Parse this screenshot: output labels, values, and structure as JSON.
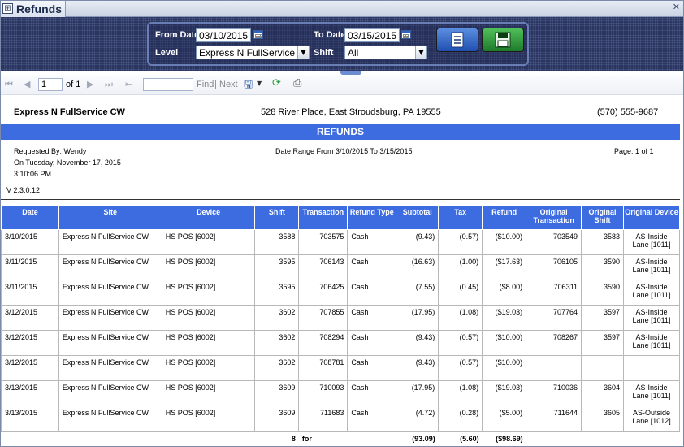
{
  "tab": {
    "title": "Refunds"
  },
  "params": {
    "from_date_label": "From Date",
    "from_date_value": "03/10/2015",
    "to_date_label": "To Date",
    "to_date_value": "03/15/2015",
    "level_label": "Level",
    "level_value": "Express N FullService CW",
    "shift_label": "Shift",
    "shift_value": "All"
  },
  "toolbar": {
    "page_value": "1",
    "page_of": "of 1",
    "find_label": "Find",
    "separator": "|",
    "next_label": "Next"
  },
  "report": {
    "company": "Express N FullService CW",
    "address": "528 River Place, East Stroudsburg, PA 19555",
    "phone": "(570) 555-9687",
    "title": "REFUNDS",
    "requested_by": "Requested By: Wendy",
    "on_date": "On Tuesday, November 17, 2015",
    "time": "3:10:06 PM",
    "date_range": "Date Range From 3/10/2015 To 3/15/2015",
    "page": "Page: 1 of 1",
    "version": "V 2.3.0.12"
  },
  "table": {
    "headers": [
      "Date",
      "Site",
      "Device",
      "Shift",
      "Transaction",
      "Refund Type",
      "Subtotal",
      "Tax",
      "Refund",
      "Original Transaction",
      "Original Shift",
      "Original Device"
    ],
    "rows": [
      [
        "3/10/2015",
        "Express N FullService CW",
        "HS POS [6002]",
        "3588",
        "703575",
        "Cash",
        "(9.43)",
        "(0.57)",
        "($10.00)",
        "703549",
        "3583",
        "AS-Inside Lane [1011]"
      ],
      [
        "3/11/2015",
        "Express N FullService CW",
        "HS POS [6002]",
        "3595",
        "706143",
        "Cash",
        "(16.63)",
        "(1.00)",
        "($17.63)",
        "706105",
        "3590",
        "AS-Inside Lane [1011]"
      ],
      [
        "3/11/2015",
        "Express N FullService CW",
        "HS POS [6002]",
        "3595",
        "706425",
        "Cash",
        "(7.55)",
        "(0.45)",
        "($8.00)",
        "706311",
        "3590",
        "AS-Inside Lane [1011]"
      ],
      [
        "3/12/2015",
        "Express N FullService CW",
        "HS POS [6002]",
        "3602",
        "707855",
        "Cash",
        "(17.95)",
        "(1.08)",
        "($19.03)",
        "707764",
        "3597",
        "AS-Inside Lane [1011]"
      ],
      [
        "3/12/2015",
        "Express N FullService CW",
        "HS POS [6002]",
        "3602",
        "708294",
        "Cash",
        "(9.43)",
        "(0.57)",
        "($10.00)",
        "708267",
        "3597",
        "AS-Inside Lane [1011]"
      ],
      [
        "3/12/2015",
        "Express N FullService CW",
        "HS POS [6002]",
        "3602",
        "708781",
        "Cash",
        "(9.43)",
        "(0.57)",
        "($10.00)",
        "",
        "",
        ""
      ],
      [
        "3/13/2015",
        "Express N FullService CW",
        "HS POS [6002]",
        "3609",
        "710093",
        "Cash",
        "(17.95)",
        "(1.08)",
        "($19.03)",
        "710036",
        "3604",
        "AS-Inside Lane [1011]"
      ],
      [
        "3/13/2015",
        "Express N FullService CW",
        "HS POS [6002]",
        "3609",
        "711683",
        "Cash",
        "(4.72)",
        "(0.28)",
        "($5.00)",
        "711644",
        "3605",
        "AS-Outside Lane [1012]"
      ]
    ],
    "totals": {
      "count": "8",
      "for_label": "for",
      "subtotal": "(93.09)",
      "tax": "(5.60)",
      "refund": "($98.69)"
    }
  }
}
